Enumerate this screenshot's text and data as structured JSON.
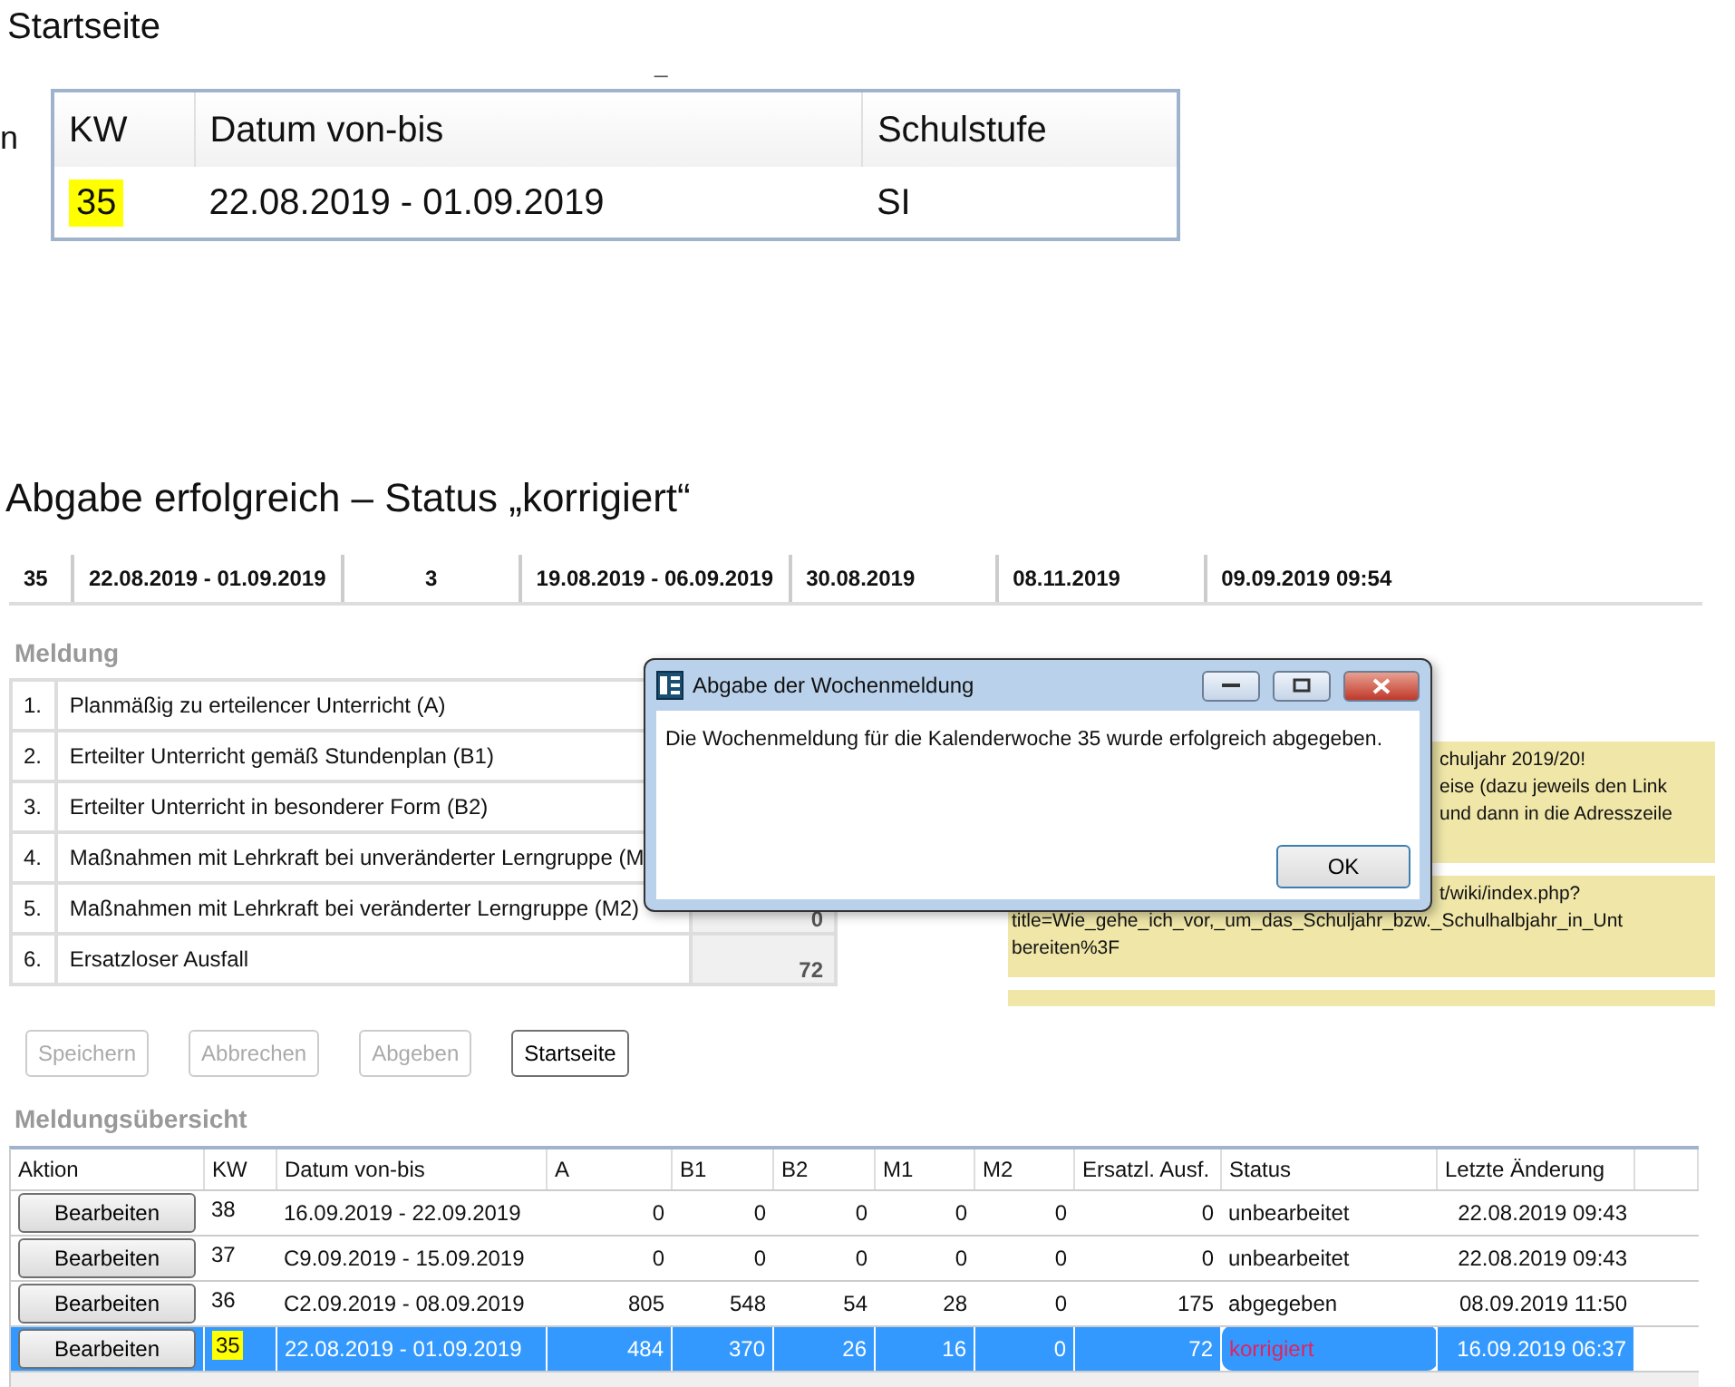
{
  "page_title": "Startseite",
  "cut_fragments": {
    "left_letter": "n",
    "mark": "_"
  },
  "start_table": {
    "columns": [
      "KW",
      "Datum von-bis",
      "Schulstufe"
    ],
    "rows": [
      {
        "kw": "35",
        "kw_highlighted": true,
        "date": "22.08.2019 - 01.09.2019",
        "level": "SI"
      }
    ]
  },
  "result_title": "Abgabe erfolgreich – Status „korrigiert“",
  "summary_row": [
    "35",
    "22.08.2019 - 01.09.2019",
    "3",
    "19.08.2019 - 06.09.2019",
    "30.08.2019",
    "08.11.2019",
    "09.09.2019 09:54"
  ],
  "meldung": {
    "title": "Meldung",
    "rows": [
      {
        "num": "1.",
        "label": "Planmäßig zu erteilencer Unterricht (A)"
      },
      {
        "num": "2.",
        "label": "Erteilter Unterricht gemäß Stundenplan (B1)"
      },
      {
        "num": "3.",
        "label": "Erteilter Unterricht in besonderer Form (B2)"
      },
      {
        "num": "4.",
        "label": "Maßnahmen mit Lehrkraft bei unveränderter Lerngruppe (M"
      },
      {
        "num": "5.",
        "label": "Maßnahmen mit Lehrkraft bei veränderter Lerngruppe (M2)",
        "value": "0"
      },
      {
        "num": "6.",
        "label": "Ersatzloser Ausfall",
        "value": "72"
      }
    ]
  },
  "notes": [
    {
      "kind": "text",
      "lines": [
        {
          "text": "chuljahr 2019/20!",
          "kind": "covered"
        },
        {
          "text": "eise (dazu jeweils den Link",
          "kind": "covered"
        },
        {
          "text": "und dann in die Adresszeile",
          "kind": "covered"
        }
      ]
    },
    {
      "kind": "text",
      "lines": [
        {
          "text": "t/wiki/index.php?",
          "kind": "covered"
        },
        {
          "text": "title=Wie_gehe_ich_vor,_um_das_Schuljahr_bzw._Schulhalbjahr_in_Unt",
          "kind": "full"
        },
        {
          "text": "bereiten%3F",
          "kind": "full"
        }
      ]
    },
    {
      "kind": "cut"
    }
  ],
  "buttons": [
    {
      "label": "Speichern",
      "disabled": true
    },
    {
      "label": "Abbrechen",
      "disabled": true
    },
    {
      "label": "Abgeben",
      "disabled": true
    },
    {
      "label": "Startseite",
      "disabled": false
    }
  ],
  "overview": {
    "title": "Meldungsübersicht",
    "columns": [
      "Aktion",
      "KW",
      "Datum von-bis",
      "A",
      "B1",
      "B2",
      "M1",
      "M2",
      "Ersatzl. Ausf.",
      "Status",
      "Letzte Änderung"
    ],
    "rows": [
      {
        "action": "Bearbeiten",
        "kw": "38",
        "kw_highlighted": false,
        "date": "16.09.2019 - 22.09.2019",
        "a": "0",
        "b1": "0",
        "b2": "0",
        "m1": "0",
        "m2": "0",
        "ersatz": "0",
        "status": "unbearbeitet",
        "alert": false,
        "changed": "22.08.2019  09:43",
        "selected": false
      },
      {
        "action": "Bearbeiten",
        "kw": "37",
        "kw_highlighted": false,
        "date": "C9.09.2019 - 15.09.2019",
        "a": "0",
        "b1": "0",
        "b2": "0",
        "m1": "0",
        "m2": "0",
        "ersatz": "0",
        "status": "unbearbeitet",
        "alert": false,
        "changed": "22.08.2019  09:43",
        "selected": false
      },
      {
        "action": "Bearbeiten",
        "kw": "36",
        "kw_highlighted": false,
        "date": "C2.09.2019 - 08.09.2019",
        "a": "805",
        "b1": "548",
        "b2": "54",
        "m1": "28",
        "m2": "0",
        "ersatz": "175",
        "status": "abgegeben",
        "alert": false,
        "changed": "08.09.2019  11:50",
        "selected": false
      },
      {
        "action": "Bearbeiten",
        "kw": "35",
        "kw_highlighted": true,
        "date": "22.08.2019 - 01.09.2019",
        "a": "484",
        "b1": "370",
        "b2": "26",
        "m1": "16",
        "m2": "0",
        "ersatz": "72",
        "status": "korrigiert",
        "alert": true,
        "changed": "16.09.2019  06:37",
        "selected": true
      }
    ]
  },
  "dialog": {
    "title": "Abgabe der Wochenmeldung",
    "message": "Die Wochenmeldung für die Kalenderwoche 35 wurde erfolgreich abgegeben.",
    "ok": "OK"
  }
}
